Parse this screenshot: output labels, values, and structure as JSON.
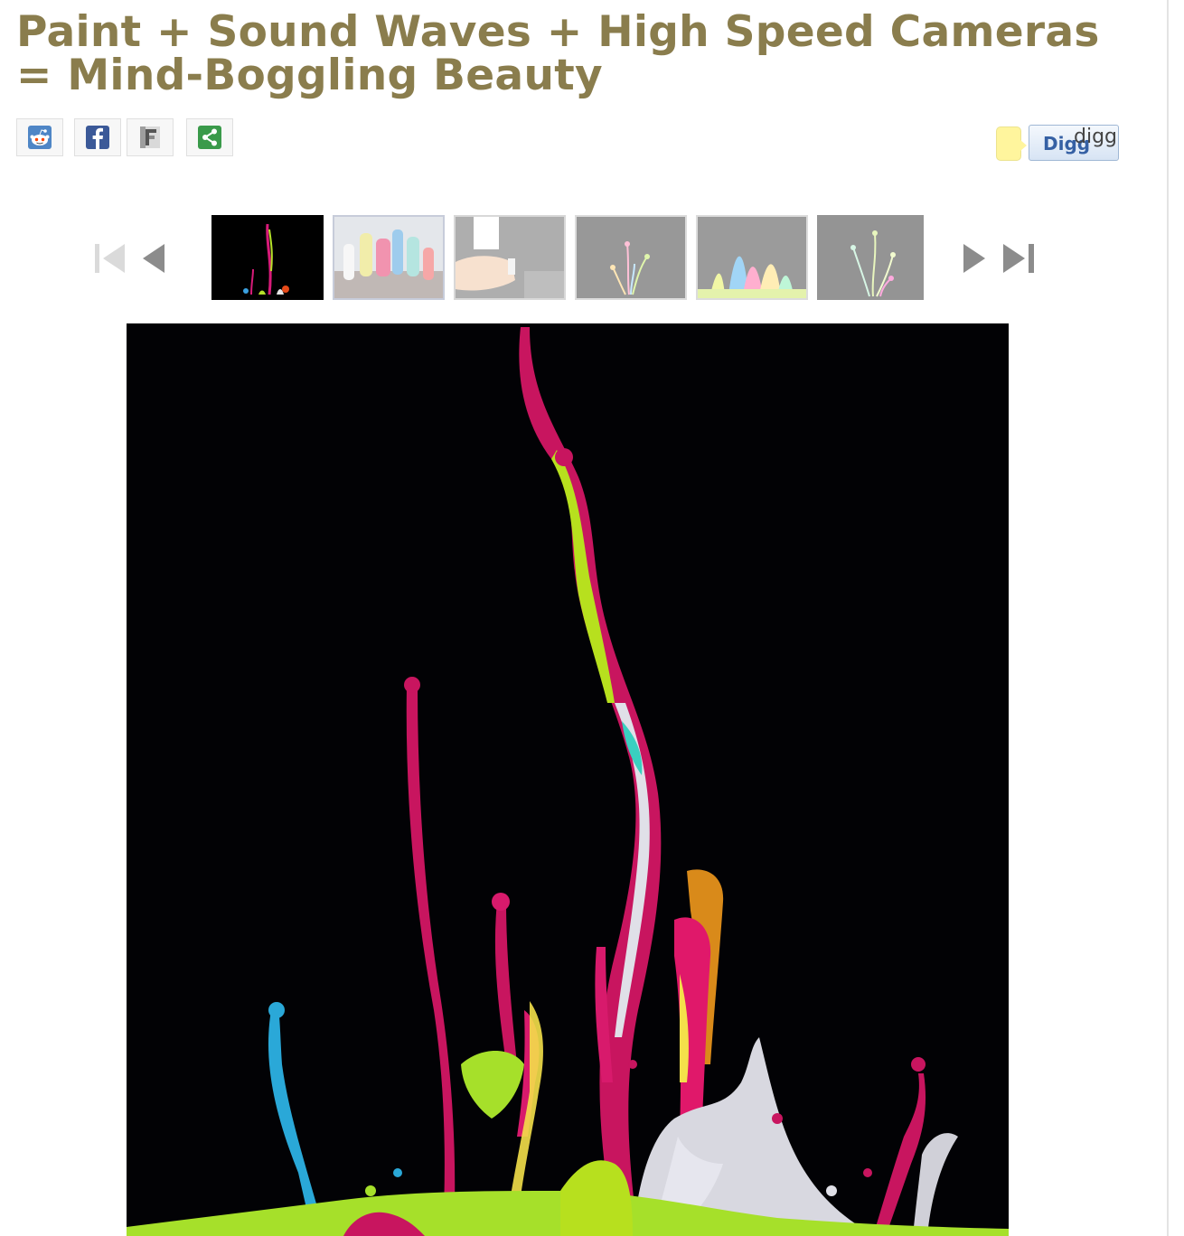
{
  "article": {
    "title": "Paint + Sound Waves + High Speed Cameras = Mind-Boggling Beauty"
  },
  "share": {
    "buttons": [
      {
        "name": "reddit",
        "icon": "reddit-alien-icon"
      },
      {
        "name": "facebook",
        "icon": "facebook-f-icon"
      },
      {
        "name": "fark",
        "icon": "fark-f-icon"
      },
      {
        "name": "share",
        "icon": "share-nodes-icon"
      }
    ]
  },
  "digg": {
    "button_label": "Digg",
    "alt_text": "digg"
  },
  "colors": {
    "title": "#8a7d4d",
    "facebook": "#3b5998",
    "share": "#3a9a4a",
    "digg_blue": "#3560a4",
    "digg_count_bg": "#fff59d"
  },
  "gallery": {
    "controls": [
      "first-icon",
      "prev-icon",
      "next-icon",
      "last-icon"
    ],
    "thumbnail_count": 6,
    "selected_index": 0
  }
}
